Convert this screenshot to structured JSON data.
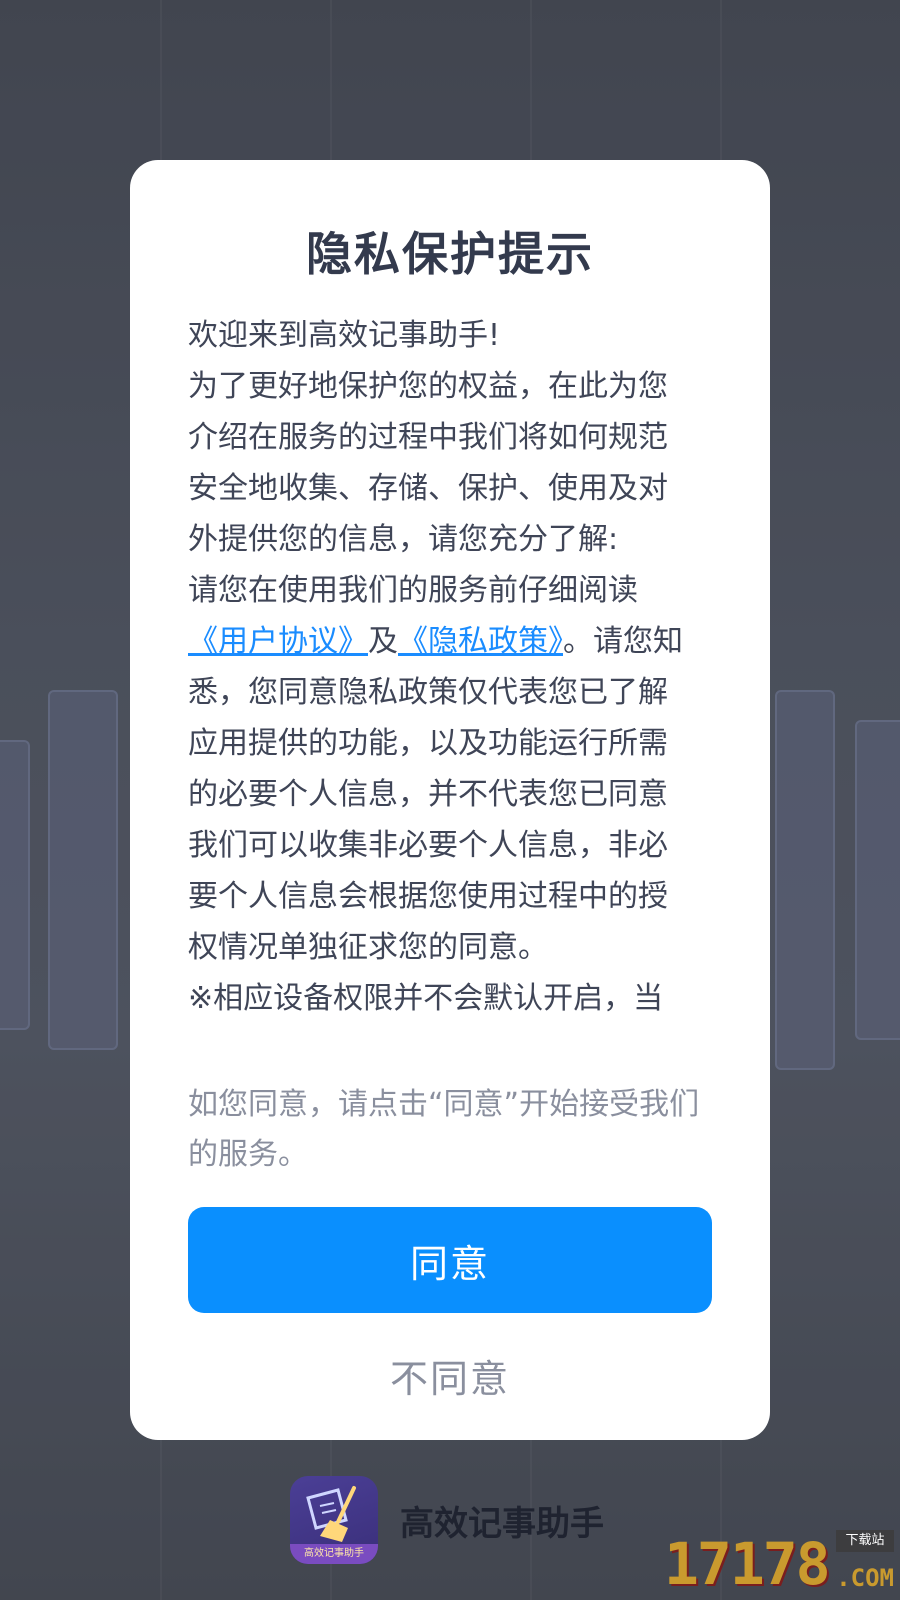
{
  "dialog": {
    "title": "隐私保护提示",
    "body": {
      "welcome": "欢迎来到高效记事助手!",
      "intro": "为了更好地保护您的权益，在此为您介绍在服务的过程中我们将如何规范安全地收集、存储、保护、使用及对外提供您的信息，请您充分了解:",
      "read_prefix": "请您在使用我们的服务前仔细阅读",
      "user_agreement_link": "《用户协议》",
      "and_word": "及",
      "privacy_policy_link": "《隐私政策》",
      "notice": "。请您知悉，您同意隐私政策仅代表您已了解应用提供的功能，以及功能运行所需的必要个人信息，并不代表您已同意我们可以收集非必要个人信息，非必要个人信息会根据您使用过程中的授权情况单独征求您的同意。",
      "permission_note": "※相应设备权限并不会默认开启，当"
    },
    "consent_text": "如您同意，请点击“同意”开始接受我们的服务。",
    "agree_label": "同意",
    "disagree_label": "不同意"
  },
  "brand": {
    "icon_label": "高效记事助手",
    "app_name": "高效记事助手"
  },
  "watermark": {
    "digits": "17178",
    "tag": "下载站",
    "suffix": ".COM"
  },
  "colors": {
    "accent": "#0a8ffe",
    "link": "#1a8cff",
    "title": "#333a4d",
    "muted": "#8a8f9e"
  }
}
